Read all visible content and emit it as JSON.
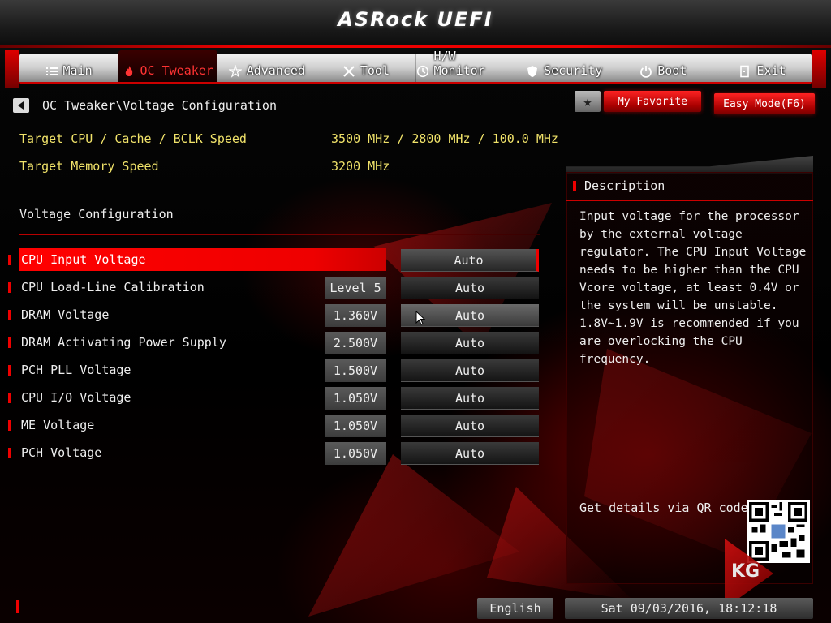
{
  "header": {
    "title": "ASRock UEFI"
  },
  "nav": {
    "tabs": [
      {
        "label": "Main",
        "icon": "list-icon",
        "active": false
      },
      {
        "label": "OC Tweaker",
        "icon": "flame-icon",
        "active": true
      },
      {
        "label": "Advanced",
        "icon": "star-sparkle-icon",
        "active": false
      },
      {
        "label": "Tool",
        "icon": "tools-icon",
        "active": false
      },
      {
        "label": "H/W Monitor",
        "icon": "monitor-icon",
        "active": false
      },
      {
        "label": "Security",
        "icon": "shield-icon",
        "active": false
      },
      {
        "label": "Boot",
        "icon": "power-icon",
        "active": false
      },
      {
        "label": "Exit",
        "icon": "exit-icon",
        "active": false
      }
    ]
  },
  "breadcrumb": "OC Tweaker\\Voltage Configuration",
  "buttons": {
    "favorite": "My Favorite",
    "easy_mode": "Easy Mode(F6)"
  },
  "info": {
    "cpu_label": "Target CPU / Cache / BCLK Speed",
    "cpu_value": "3500 MHz / 2800 MHz / 100.0 MHz",
    "mem_label": "Target Memory Speed",
    "mem_value": "3200 MHz"
  },
  "section_title": "Voltage Configuration",
  "rows": [
    {
      "label": "CPU Input Voltage",
      "current": "",
      "value": "Auto"
    },
    {
      "label": "CPU Load-Line Calibration",
      "current": "Level 5",
      "value": "Auto"
    },
    {
      "label": "DRAM Voltage",
      "current": "1.360V",
      "value": "Auto"
    },
    {
      "label": "DRAM Activating Power Supply",
      "current": "2.500V",
      "value": "Auto"
    },
    {
      "label": "PCH PLL Voltage",
      "current": "1.500V",
      "value": "Auto"
    },
    {
      "label": "CPU I/O Voltage",
      "current": "1.050V",
      "value": "Auto"
    },
    {
      "label": "ME Voltage",
      "current": "1.050V",
      "value": "Auto"
    },
    {
      "label": "PCH Voltage",
      "current": "1.050V",
      "value": "Auto"
    }
  ],
  "description": {
    "title": "Description",
    "text": "Input voltage for the processor\nby the external voltage\nregulator. The CPU Input Voltage\nneeds to be higher than the CPU\nVcore voltage, at least 0.4V or\nthe system will be unstable.\n1.8V~1.9V is recommended if you\nare overlocking the CPU frequency.",
    "qr_label": "Get details via QR code"
  },
  "footer": {
    "language": "English",
    "datetime": "Sat 09/03/2016, 18:12:18"
  },
  "watermark": "KG",
  "colors": {
    "accent": "#e00000",
    "info_text": "#f1e36a"
  }
}
